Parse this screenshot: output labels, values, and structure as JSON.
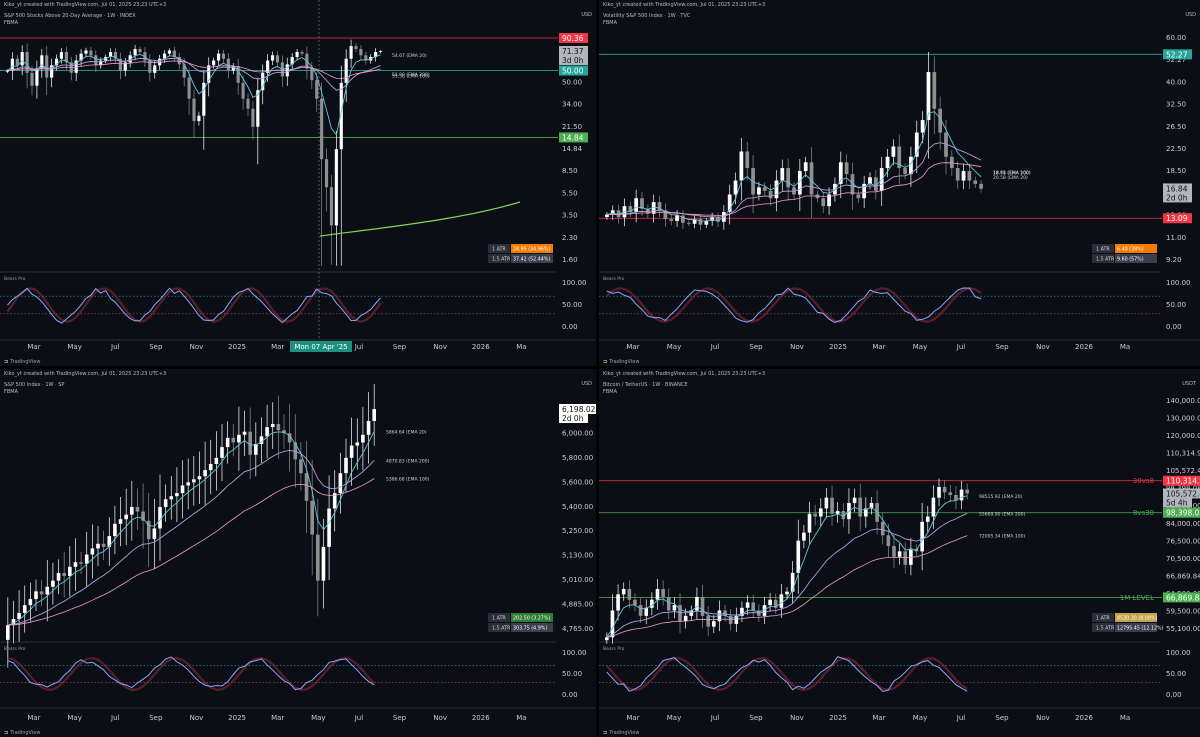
{
  "colors": {
    "bg": "#0c0e15",
    "up": "#ffffff",
    "down": "#8f8f8f",
    "red": "#f23645",
    "green": "#4caf50",
    "teal": "#26a69a",
    "cyan": "#5fc8d8",
    "purple": "#b39ddb",
    "pink": "#e8a0c8",
    "orange": "#f57c00",
    "osc": "#8aa8ff",
    "grid": "#1e222d"
  },
  "panels": [
    {
      "id": "s5fd",
      "header_1": "Kiko_yt created with TradingView.com, Jul 01, 2025 23:23 UTC+3",
      "header_2": "S&P 500 Stocks Above 20-Day Average · 1W · INDEX",
      "header_3": "FBMA",
      "currency": "USD",
      "footer": "TradingView",
      "chart_data": {
        "type": "candlestick",
        "x_labels": [
          "Mar",
          "May",
          "Jul",
          "Sep",
          "Nov",
          "2025",
          "Mar",
          "May",
          "Jul",
          "Sep",
          "Nov",
          "2026",
          "Ma"
        ],
        "crosshair_label": "Mon 07 Apr '25",
        "y_ticks": [
          "90.36",
          "71.37",
          "50.00",
          "34.00",
          "21.50",
          "14.84",
          "8.50",
          "5.50",
          "3.50",
          "2.30",
          "1.60"
        ],
        "price_tags": [
          {
            "text": "90.36",
            "kind": "red"
          },
          {
            "text": "71.37",
            "kind": "last"
          },
          {
            "text": "3d 0h",
            "kind": "timer"
          },
          {
            "text": "50.00",
            "kind": "teal"
          },
          {
            "text": "14.84",
            "kind": "green"
          }
        ],
        "ema_labels": [
          "54.67 (EMA 20)",
          "51.80 (EMA 200)",
          "55.38 (EMA 100)"
        ],
        "atr": [
          {
            "label": "1 ATR",
            "value": "24.95 (34.96%)"
          },
          {
            "label": "1.5 ATR",
            "value": "37.42 (52.44%)"
          }
        ],
        "osc_ticks": [
          "100.00",
          "50.00",
          "0.00"
        ],
        "osc_title": "Bears Pro",
        "hlines": [
          {
            "label": "90.36",
            "color": "red"
          },
          {
            "label": "50.00",
            "color": "teal"
          },
          {
            "label": "14.84",
            "color": "green"
          }
        ],
        "series_closes": [
          50,
          62,
          55,
          70,
          48,
          38,
          52,
          66,
          44,
          55,
          62,
          70,
          58,
          48,
          60,
          68,
          72,
          66,
          55,
          60,
          64,
          70,
          62,
          50,
          58,
          66,
          74,
          70,
          60,
          48,
          55,
          62,
          68,
          72,
          64,
          56,
          44,
          30,
          20,
          22,
          40,
          55,
          60,
          68,
          62,
          50,
          54,
          40,
          30,
          25,
          18,
          35,
          48,
          60,
          66,
          58,
          45,
          56,
          64,
          70,
          68,
          52,
          42,
          30,
          10,
          6,
          3,
          12,
          40,
          62,
          78,
          74,
          66,
          60,
          64,
          70,
          71
        ]
      }
    },
    {
      "id": "vix",
      "header_1": "Kiko_yt created with TradingView.com, Jul 01, 2025 23:23 UTC+3",
      "header_2": "Volatility S&P 500 Index · 1W · TVC",
      "header_3": "FBMA",
      "currency": "USD",
      "footer": "TradingView",
      "chart_data": {
        "type": "candlestick",
        "x_labels": [
          "Mar",
          "May",
          "Jul",
          "Sep",
          "Nov",
          "2025",
          "Mar",
          "May",
          "Jul",
          "Sep",
          "Nov",
          "2026",
          "Ma"
        ],
        "y_ticks": [
          "60.00",
          "52.27",
          "40.00",
          "32.50",
          "26.50",
          "22.50",
          "18.50",
          "16.84",
          "13.09",
          "11.00",
          "9.20"
        ],
        "price_tags": [
          {
            "text": "52.27",
            "kind": "teal"
          },
          {
            "text": "16.84",
            "kind": "last"
          },
          {
            "text": "2d 0h",
            "kind": "timer"
          },
          {
            "text": "13.09",
            "kind": "red"
          }
        ],
        "ema_labels": [
          "20.58 (EMA 20)",
          "18.78 (EMA 200)",
          "18.61 (EMA 100)"
        ],
        "atr": [
          {
            "label": "1 ATR",
            "value": "6.40 (38%)"
          },
          {
            "label": "1.5 ATR",
            "value": "9.60 (57%)"
          }
        ],
        "osc_ticks": [
          "100.00",
          "50.00",
          "0.00"
        ],
        "osc_title": "Bears Pro",
        "hlines": [
          {
            "label": "52.27",
            "color": "teal"
          },
          {
            "label": "13.09",
            "color": "red"
          }
        ],
        "series_closes": [
          13.5,
          14,
          13.2,
          14.5,
          13.8,
          15.5,
          14.2,
          13.6,
          15,
          14,
          13,
          12.8,
          13.4,
          12.6,
          12.5,
          13,
          12.4,
          12.8,
          13.2,
          12.7,
          13.8,
          16,
          18,
          23,
          20,
          16,
          17,
          16.5,
          15.5,
          18,
          20,
          17,
          16,
          19.5,
          21,
          16,
          15.5,
          14.5,
          16,
          17.5,
          21,
          19,
          16,
          15.5,
          17.5,
          18.5,
          16.5,
          20,
          22,
          24,
          20,
          19,
          22,
          27,
          30,
          45,
          33,
          27,
          22,
          20,
          18,
          19.5,
          18,
          17.5,
          16.8
        ]
      }
    },
    {
      "id": "spx",
      "header_1": "Kiko_yt created with TradingView.com, Jul 01, 2025 23:23 UTC+3",
      "header_2": "S&P 500 Index · 1W · SP",
      "header_3": "FBMA",
      "currency": "USD",
      "footer": "TradingView",
      "chart_data": {
        "type": "candlestick",
        "x_labels": [
          "Mar",
          "May",
          "Jul",
          "Sep",
          "Nov",
          "2025",
          "Mar",
          "May",
          "Jul",
          "Sep",
          "Nov",
          "2026",
          "Ma"
        ],
        "y_ticks": [
          "6,198.02",
          "6,000.00",
          "5,800.00",
          "5,600.00",
          "5,400.00",
          "5,250.00",
          "5,130.00",
          "5,010.00",
          "4,885.00",
          "4,765.00"
        ],
        "price_tags": [
          {
            "text": "6,198.02",
            "kind": "last_white"
          },
          {
            "text": "2d 0h",
            "kind": "timer_white"
          }
        ],
        "ema_labels": [
          "5864.64 (EMA 20)",
          "5386.68 (EMA 100)",
          "4870.83 (EMA 200)"
        ],
        "atr": [
          {
            "label": "1 ATR",
            "value": "202.50 (3.27%)"
          },
          {
            "label": "1.5 ATR",
            "value": "303.75 (4.9%)"
          }
        ],
        "osc_ticks": [
          "100.00",
          "50.00",
          "0.00"
        ],
        "osc_title": "Bears Pro",
        "series_closes": [
          4790,
          4830,
          4870,
          4920,
          4960,
          5010,
          4990,
          5040,
          5080,
          5130,
          5110,
          5170,
          5200,
          5190,
          5250,
          5290,
          5320,
          5300,
          5370,
          5450,
          5480,
          5510,
          5560,
          5530,
          5470,
          5350,
          5420,
          5560,
          5610,
          5630,
          5650,
          5700,
          5720,
          5740,
          5760,
          5800,
          5840,
          5880,
          5950,
          6010,
          5980,
          6030,
          6050,
          5900,
          5970,
          6020,
          6080,
          6100,
          6060,
          6040,
          5980,
          5870,
          5780,
          5600,
          5380,
          5080,
          5300,
          5550,
          5650,
          5780,
          5880,
          5960,
          5980,
          6030,
          6120,
          6198
        ]
      }
    },
    {
      "id": "btc",
      "header_1": "Kiko_yt created with TradingView.com, Jul 01, 2025 23:23 UTC+3",
      "header_2": "Bitcoin / TetherUS · 1W · BINANCE",
      "header_3": "FBMA",
      "currency": "USDT",
      "footer": "TradingView",
      "chart_data": {
        "type": "candlestick",
        "x_labels": [
          "Mar",
          "May",
          "Jul",
          "Sep",
          "Nov",
          "2025",
          "Mar",
          "May",
          "Jul",
          "Sep",
          "Nov",
          "2026",
          "Ma"
        ],
        "y_ticks": [
          "140,000.00",
          "130,000.00",
          "120,000.00",
          "110,314.91",
          "105,572.42",
          "98,398.08",
          "92,000.00",
          "84,000.00",
          "76,500.00",
          "70,500.00",
          "66,869.84",
          "64,500.00",
          "59,500.00",
          "55,100.00"
        ],
        "price_tags": [
          {
            "text": "110,314.91",
            "kind": "red"
          },
          {
            "text": "105,572.42",
            "kind": "last"
          },
          {
            "text": "5d 4h",
            "kind": "timer"
          },
          {
            "text": "98,398.08",
            "kind": "green"
          },
          {
            "text": "66,869.84",
            "kind": "green"
          }
        ],
        "level_labels": [
          {
            "text": "30vs8",
            "color": "red"
          },
          {
            "text": "8vs30",
            "color": "green"
          },
          {
            "text": "1M LEVEL",
            "color": "green"
          }
        ],
        "ema_labels": [
          "98515.92 (EMA 20)",
          "72095.34 (EMA 100)",
          "55669.90 (EMA 200)"
        ],
        "atr": [
          {
            "label": "1 ATR",
            "value": "8530.30 (8.08%)"
          },
          {
            "label": "1.5 ATR",
            "value": "12795.45 (12.12%)"
          }
        ],
        "osc_ticks": [
          "100.00",
          "50.00",
          "0.00"
        ],
        "osc_title": "Bears Pro",
        "series_closes": [
          52000,
          62000,
          68000,
          70000,
          66000,
          64000,
          60000,
          63000,
          66000,
          70000,
          67000,
          62000,
          64000,
          58000,
          60000,
          62000,
          67000,
          60000,
          56000,
          58000,
          62000,
          60000,
          57000,
          60000,
          63000,
          65000,
          62000,
          60000,
          64000,
          66000,
          63000,
          68000,
          69000,
          76000,
          88000,
          91000,
          98000,
          97000,
          100000,
          104000,
          98000,
          99000,
          96000,
          102000,
          104000,
          97000,
          100000,
          102000,
          95000,
          90000,
          86000,
          82000,
          84000,
          79000,
          85000,
          84000,
          95000,
          97000,
          104000,
          108000,
          106000,
          105000,
          103000,
          107000,
          105572
        ]
      }
    }
  ]
}
